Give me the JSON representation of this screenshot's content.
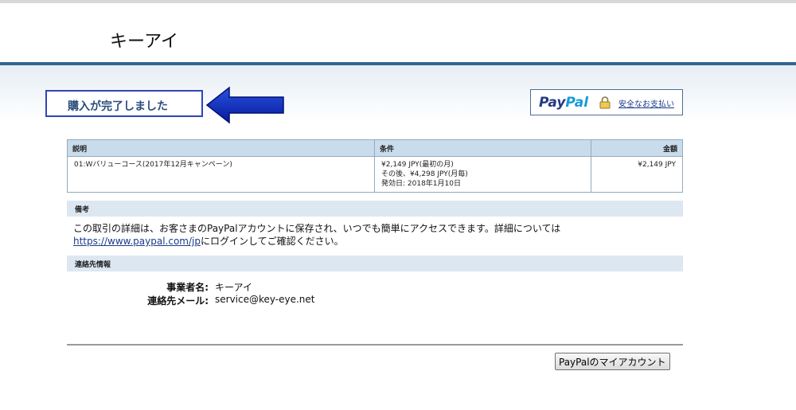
{
  "merchant": {
    "name": "キーアイ"
  },
  "status": {
    "message": "購入が完了しました",
    "accent_color": "#2e46b8",
    "arrow_color": "#0a2fc0"
  },
  "paypal": {
    "logo_pay": "Pay",
    "logo_pal": "Pal",
    "secure_link": "安全なお支払い"
  },
  "table": {
    "headers": {
      "description": "説明",
      "terms": "条件",
      "amount": "金額"
    },
    "rows": [
      {
        "description": "01:Wバリューコース(2017年12月キャンペーン)",
        "terms": [
          "¥2,149 JPY(最初の月)",
          "その後、¥4,298 JPY(月毎)",
          "発効日: 2018年1月10日"
        ],
        "amount": "¥2,149 JPY"
      }
    ]
  },
  "notes": {
    "header": "備考",
    "text_before": "この取引の詳細は、お客さまのPayPalアカウントに保存され、いつでも簡単にアクセスできます。詳細については",
    "link": "https://www.paypal.com/jp",
    "text_after": "にログインしてご確認ください。"
  },
  "contact": {
    "header": "連絡先情報",
    "business_label": "事業者名:",
    "business_value": "キーアイ",
    "email_label": "連絡先メール:",
    "email_value": "service@key-eye.net"
  },
  "buttons": {
    "my_account": "PayPalのマイアカウント"
  }
}
